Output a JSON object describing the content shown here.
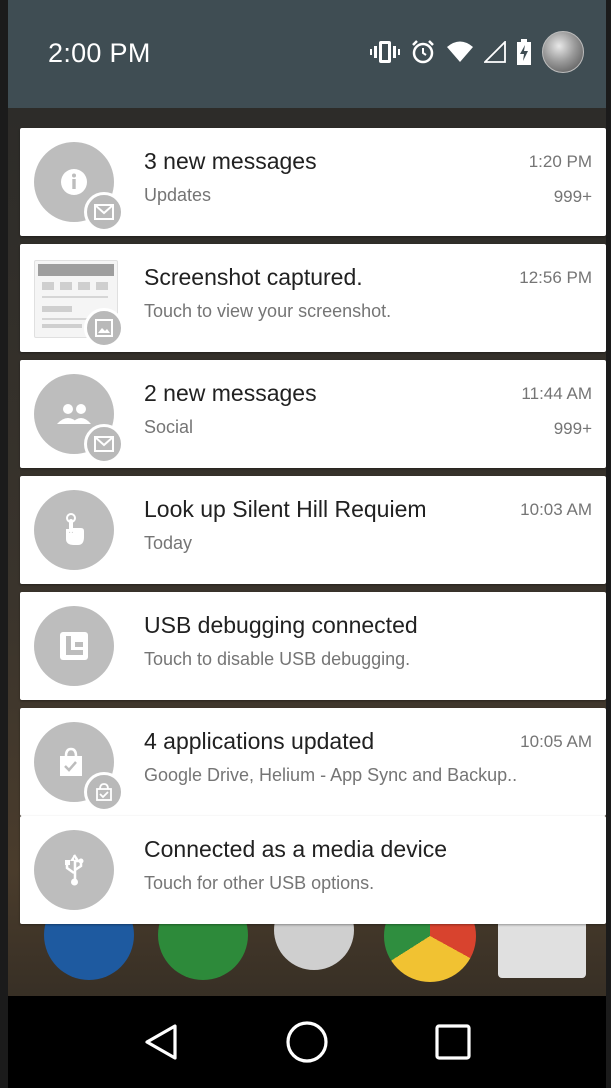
{
  "status_bar": {
    "time": "2:00 PM",
    "icons": [
      "vibrate-icon",
      "alarm-icon",
      "wifi-icon",
      "signal-icon",
      "battery-icon",
      "avatar"
    ]
  },
  "notifications": [
    {
      "title": "3 new messages",
      "text": "Updates",
      "time": "1:20 PM",
      "count": "999+",
      "icon": "info-icon",
      "badge": "mail-icon"
    },
    {
      "title": "Screenshot captured.",
      "text": "Touch to view your screenshot.",
      "time": "12:56 PM",
      "count": "",
      "icon": "screenshot-thumbnail",
      "badge": "image-icon"
    },
    {
      "title": "2 new messages",
      "text": "Social",
      "time": "11:44 AM",
      "count": "999+",
      "icon": "people-icon",
      "badge": "mail-icon"
    },
    {
      "title": "Look up Silent Hill Requiem",
      "text": "Today",
      "time": "10:03 AM",
      "count": "",
      "icon": "touch-icon",
      "badge": ""
    },
    {
      "title": "USB debugging connected",
      "text": "Touch to disable USB debugging.",
      "time": "",
      "count": "",
      "icon": "usb-debug-icon",
      "badge": ""
    },
    {
      "title": "4 applications updated",
      "text": "Google Drive, Helium - App Sync and Backup..",
      "time": "10:05 AM",
      "count": "",
      "icon": "shopping-bag-icon",
      "badge": "shopping-bag-icon"
    },
    {
      "title": "Connected as a media device",
      "text": "Touch for other USB options.",
      "time": "",
      "count": "",
      "icon": "usb-icon",
      "badge": ""
    }
  ],
  "nav_bar": {
    "buttons": [
      "back-button",
      "home-button",
      "recents-button"
    ]
  },
  "colors": {
    "status_bar": "#3f4d53",
    "card": "#ffffff",
    "icon_circle": "#bdbdbd",
    "title_text": "#212121",
    "secondary_text": "#757575"
  }
}
